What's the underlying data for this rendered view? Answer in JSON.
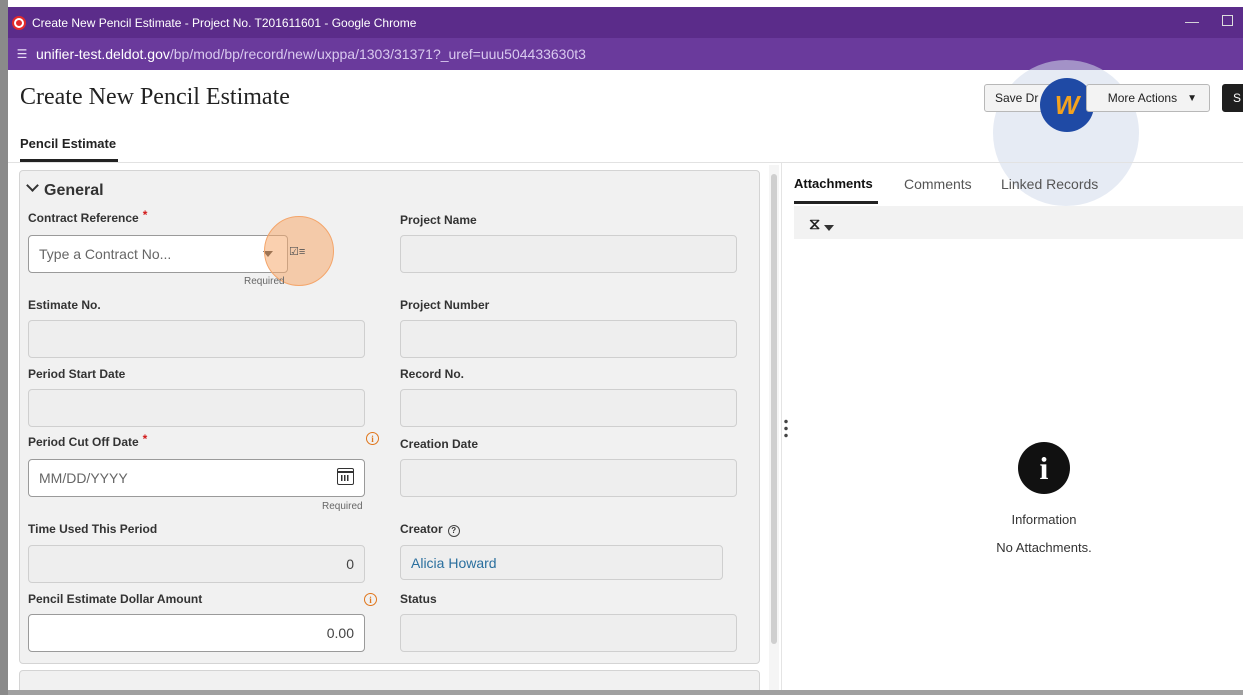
{
  "window": {
    "title": "Create New Pencil Estimate - Project No. T201611601 - Google Chrome",
    "minimize": "—"
  },
  "address_bar": {
    "host": "unifier-test.deldot.gov",
    "path": "/bp/mod/bp/record/new/uxppa/1303/31371?_uref=uuu504433630t3"
  },
  "header": {
    "title": "Create New Pencil Estimate",
    "save_draft_label": "Save Dr",
    "more_actions_label": "More Actions",
    "submit_label": "S"
  },
  "walkme": {
    "logo_text": "W"
  },
  "tabs": {
    "main_tab": "Pencil Estimate"
  },
  "form": {
    "section_title": "General",
    "required_mark": "*",
    "required_note": "Required",
    "contract_reference": {
      "label": "Contract Reference",
      "placeholder": "Type a Contract No...",
      "picker_icon": "☑≡"
    },
    "project_name": {
      "label": "Project Name",
      "value": ""
    },
    "estimate_no": {
      "label": "Estimate No.",
      "value": ""
    },
    "project_number": {
      "label": "Project Number",
      "value": ""
    },
    "period_start_date": {
      "label": "Period Start Date",
      "value": ""
    },
    "record_no": {
      "label": "Record No.",
      "value": ""
    },
    "period_cut_off_date": {
      "label": "Period Cut Off Date",
      "placeholder": "MM/DD/YYYY"
    },
    "creation_date": {
      "label": "Creation Date",
      "value": ""
    },
    "time_used_this_period": {
      "label": "Time Used This Period",
      "value": "0"
    },
    "creator": {
      "label": "Creator",
      "value": "Alicia Howard"
    },
    "pencil_estimate_dollar_amount": {
      "label": "Pencil Estimate Dollar Amount",
      "value": "0.00"
    },
    "status": {
      "label": "Status",
      "value": ""
    },
    "info_glyph": "i",
    "help_glyph": "?"
  },
  "right_pane": {
    "tabs": [
      "Attachments",
      "Comments",
      "Linked Records"
    ],
    "attach_icon": "📎",
    "info_glyph": "i",
    "info_title": "Information",
    "info_message": "No Attachments."
  }
}
